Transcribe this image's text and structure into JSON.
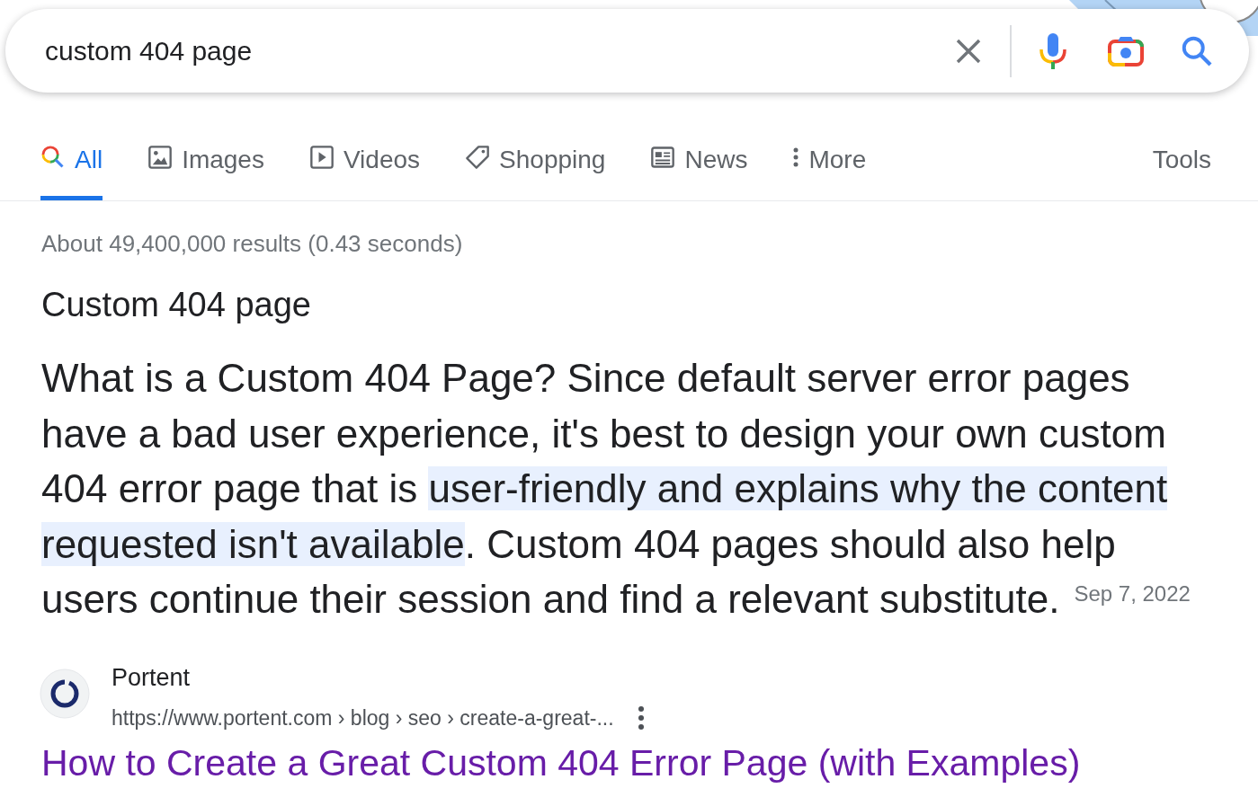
{
  "search": {
    "value": "custom 404 page"
  },
  "tabs": [
    {
      "label": "All",
      "kind": "search",
      "selected": true
    },
    {
      "label": "Images",
      "kind": "image",
      "selected": false
    },
    {
      "label": "Videos",
      "kind": "play",
      "selected": false
    },
    {
      "label": "Shopping",
      "kind": "tag",
      "selected": false
    },
    {
      "label": "News",
      "kind": "news",
      "selected": false
    },
    {
      "label": "More",
      "kind": "dots",
      "selected": false
    }
  ],
  "tools": "Tools",
  "result_stats": "About 49,400,000 results (0.43 seconds)",
  "featured_snippet": {
    "heading": "Custom 404 page",
    "parts": [
      {
        "text": "What is a Custom 404 Page? Since default server error pages have a bad user experience, it's best to design your own custom 404 error page that is ",
        "highlighted": false
      },
      {
        "text": "user-friendly and explains why the content requested isn't available",
        "highlighted": true
      },
      {
        "text": ". Custom 404 pages should also help users continue their session and find a relevant substitute.",
        "highlighted": false
      }
    ],
    "date": "Sep 7, 2022"
  },
  "result": {
    "site": "Portent",
    "url": "https://www.portent.com › blog › seo › create-a-great-...",
    "title": "How to Create a Great Custom 404 Error Page (with Examples)"
  }
}
